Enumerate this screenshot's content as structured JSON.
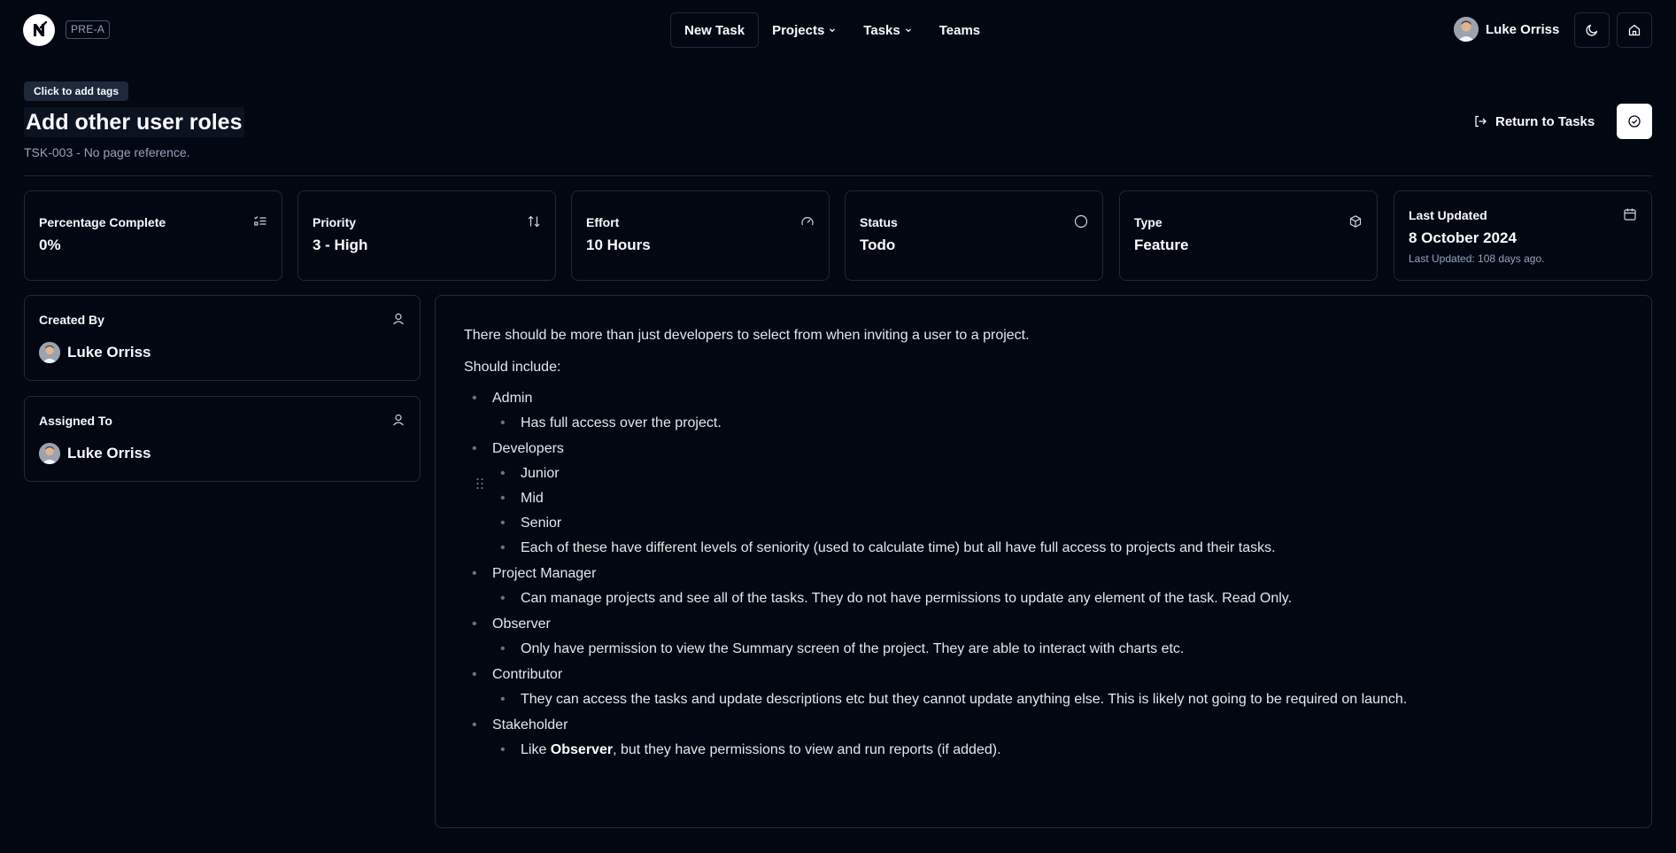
{
  "header": {
    "org_badge": "PRE-A",
    "nav": {
      "new_task": "New Task",
      "projects": "Projects",
      "tasks": "Tasks",
      "teams": "Teams"
    },
    "user_name": "Luke Orriss",
    "icons": [
      "logo-icon",
      "moon-icon",
      "home-icon",
      "chevron-down-icon"
    ]
  },
  "task": {
    "tag_chip": "Click to add tags",
    "title": "Add other user roles",
    "subtitle": "TSK-003 - No page reference.",
    "return_label": "Return to Tasks"
  },
  "stats": [
    {
      "label": "Percentage Complete",
      "value": "0%",
      "icon": "list-check-icon"
    },
    {
      "label": "Priority",
      "value": "3 - High",
      "icon": "sort-arrows-icon"
    },
    {
      "label": "Effort",
      "value": "10 Hours",
      "icon": "gauge-icon"
    },
    {
      "label": "Status",
      "value": "Todo",
      "icon": "circle-icon"
    },
    {
      "label": "Type",
      "value": "Feature",
      "icon": "package-icon"
    },
    {
      "label": "Last Updated",
      "value": "8 October 2024",
      "note": "Last Updated: 108 days ago.",
      "icon": "calendar-icon"
    }
  ],
  "people": {
    "created_by": {
      "label": "Created By",
      "name": "Luke Orriss"
    },
    "assigned_to": {
      "label": "Assigned To",
      "name": "Luke Orriss"
    }
  },
  "description": {
    "intro": "There should be more than just developers to select from when inviting a user to a project.",
    "should_include": "Should include:",
    "roles": [
      {
        "name": "Admin",
        "items": [
          "Has full access over the project."
        ]
      },
      {
        "name": "Developers",
        "items": [
          "Junior",
          "Mid",
          "Senior",
          "Each of these have different levels of seniority (used to calculate time) but all have full access to projects and their tasks."
        ]
      },
      {
        "name": "Project Manager",
        "items": [
          "Can manage projects and see all of the tasks. They do not have permissions to update any element of the task. Read Only."
        ]
      },
      {
        "name": "Observer",
        "items": [
          "Only have permission to view the Summary screen of the project. They are able to interact with charts etc."
        ]
      },
      {
        "name": "Contributor",
        "items": [
          "They can access the tasks and update descriptions etc but they cannot update anything else. This is likely not going to be required on launch."
        ]
      },
      {
        "name": "Stakeholder",
        "items_rich": {
          "prefix": "Like ",
          "bold": "Observer",
          "suffix": ", but they have permissions to view and run reports (if added)."
        }
      }
    ]
  },
  "colors": {
    "background": "#030712",
    "border": "#1e293b",
    "text": "#f8fafc",
    "muted": "#94a3b8"
  }
}
